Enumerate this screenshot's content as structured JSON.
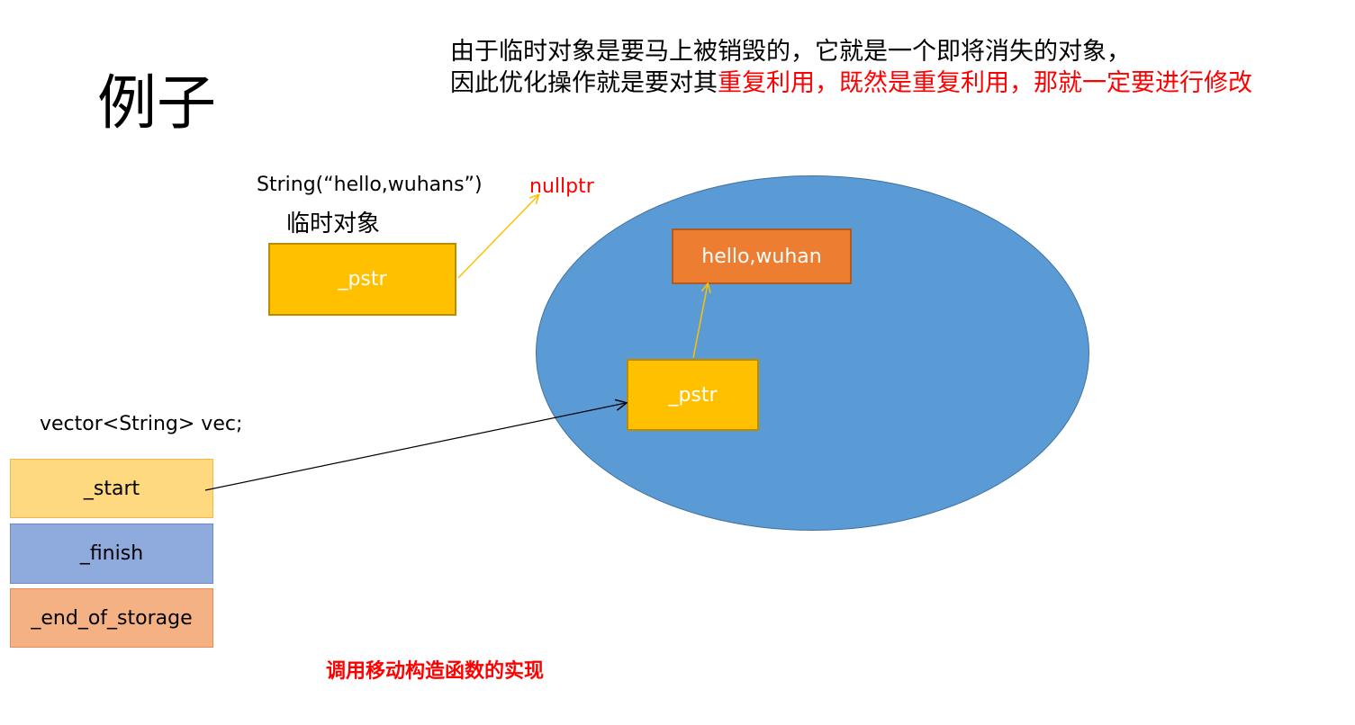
{
  "title": "例子",
  "note": {
    "line1": "由于临时对象是要马上被销毁的，它就是一个即将消失的对象，",
    "line2_black": "因此优化操作就是要对其",
    "line2_red": "重复利用，既然是重复利用，那就一定要进行修改"
  },
  "temp": {
    "constructor_text": "String(“hello,wuhans”)",
    "label": "临时对象",
    "pstr_label": "_pstr",
    "nullptr_label": "nullptr"
  },
  "heap": {
    "string_label": "hello,wuhan",
    "pstr_label": "_pstr"
  },
  "vector": {
    "declaration": "vector<String> vec;",
    "cells": [
      "_start",
      "_finish",
      "_end_of_storage"
    ]
  },
  "caption": "调用移动构造函数的实现",
  "colors": {
    "ellipse": "#5b9bd5",
    "pstr_box": "#ffc000",
    "heap_string": "#ed7d31",
    "start_cell": "#ffd97f",
    "finish_cell": "#8faadc",
    "end_cell": "#f4b183",
    "highlight_text": "#ff0000",
    "arrow_yellow": "#ffc000",
    "arrow_black": "#000000"
  }
}
